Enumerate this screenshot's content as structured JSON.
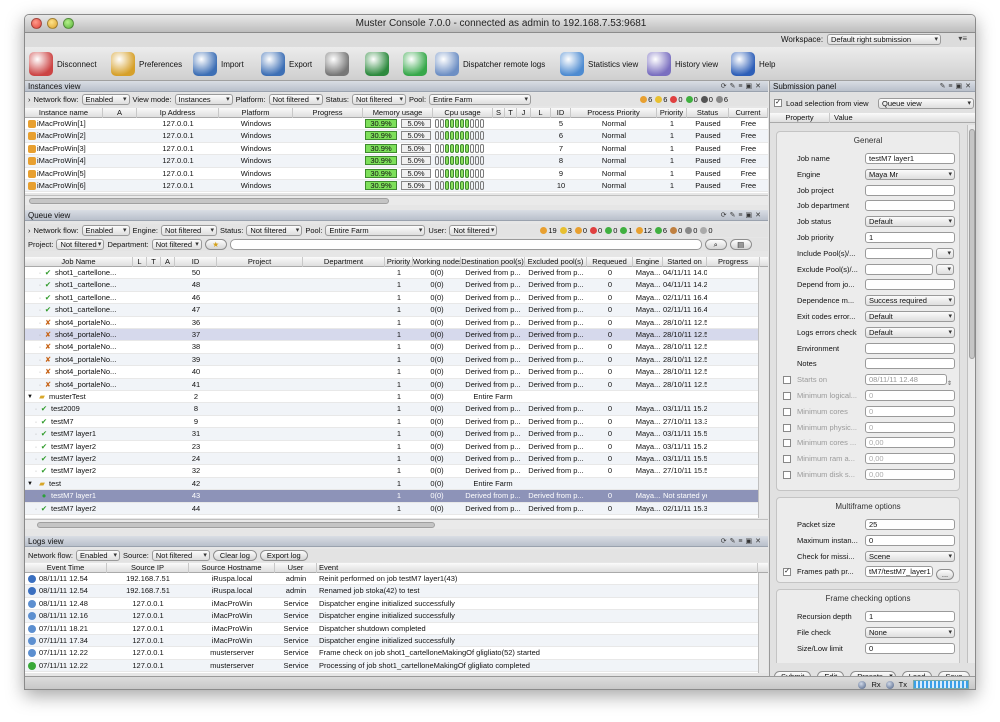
{
  "window": {
    "title": "Muster Console 7.0.0 - connected as admin to 192.168.7.53:9681"
  },
  "workspace": {
    "label": "Workspace:",
    "value": "Default right submission"
  },
  "toolbar": [
    {
      "label": "Disconnect",
      "icon": "disconnect-icon"
    },
    {
      "label": "Preferences",
      "icon": "preferences-icon"
    },
    {
      "label": "Import",
      "icon": "import-icon"
    },
    {
      "label": "Export",
      "icon": "export-icon"
    },
    {
      "label": "",
      "icon": "gears-icon"
    },
    {
      "label": "",
      "icon": "globe-refresh-icon"
    },
    {
      "label": "",
      "icon": "add-icon"
    },
    {
      "label": "Dispatcher remote logs",
      "icon": "document-icon"
    },
    {
      "label": "Statistics view",
      "icon": "statistics-icon"
    },
    {
      "label": "History view",
      "icon": "history-icon"
    },
    {
      "label": "Help",
      "icon": "help-icon"
    }
  ],
  "instances": {
    "title": "Instances view",
    "filters": {
      "network_label": "Network flow:",
      "network": "Enabled",
      "viewmode_label": "View mode:",
      "viewmode": "Instances",
      "platform_label": "Platform:",
      "platform": "Not filtered",
      "status_label": "Status:",
      "status": "Not filtered",
      "pool_label": "Pool:",
      "pool": "Entire Farm",
      "counts": [
        "6",
        "6",
        "0",
        "0",
        "0",
        "6"
      ]
    },
    "columns": [
      "Instance name",
      "A",
      "Ip Address",
      "Platform",
      "Progress",
      "Memory usage",
      "Cpu usage",
      "S",
      "T",
      "J",
      "L",
      "ID",
      "Process Priority",
      "Priority",
      "Status",
      "Current"
    ],
    "rows": [
      {
        "name": "iMacProWin[1]",
        "ip": "127.0.0.1",
        "platform": "Windows",
        "mem1": "30.9%",
        "mem2": "5.0%",
        "id": "5",
        "pp": "Normal",
        "prio": "1",
        "status": "Paused",
        "cur": "Free"
      },
      {
        "name": "iMacProWin[2]",
        "ip": "127.0.0.1",
        "platform": "Windows",
        "mem1": "30.9%",
        "mem2": "5.0%",
        "id": "6",
        "pp": "Normal",
        "prio": "1",
        "status": "Paused",
        "cur": "Free"
      },
      {
        "name": "iMacProWin[3]",
        "ip": "127.0.0.1",
        "platform": "Windows",
        "mem1": "30.9%",
        "mem2": "5.0%",
        "id": "7",
        "pp": "Normal",
        "prio": "1",
        "status": "Paused",
        "cur": "Free"
      },
      {
        "name": "iMacProWin[4]",
        "ip": "127.0.0.1",
        "platform": "Windows",
        "mem1": "30.9%",
        "mem2": "5.0%",
        "id": "8",
        "pp": "Normal",
        "prio": "1",
        "status": "Paused",
        "cur": "Free"
      },
      {
        "name": "iMacProWin[5]",
        "ip": "127.0.0.1",
        "platform": "Windows",
        "mem1": "30.9%",
        "mem2": "5.0%",
        "id": "9",
        "pp": "Normal",
        "prio": "1",
        "status": "Paused",
        "cur": "Free"
      },
      {
        "name": "iMacProWin[6]",
        "ip": "127.0.0.1",
        "platform": "Windows",
        "mem1": "30.9%",
        "mem2": "5.0%",
        "id": "10",
        "pp": "Normal",
        "prio": "1",
        "status": "Paused",
        "cur": "Free"
      }
    ]
  },
  "queue": {
    "title": "Queue view",
    "filters": {
      "network_label": "Network flow:",
      "network": "Enabled",
      "engine_label": "Engine:",
      "engine": "Not filtered",
      "status_label": "Status:",
      "status": "Not filtered",
      "pool_label": "Pool:",
      "pool": "Entire Farm",
      "user_label": "User:",
      "user": "Not filtered",
      "project_label": "Project:",
      "project": "Not filtered",
      "department_label": "Department:",
      "department": "Not filtered",
      "counts": [
        "19",
        "3",
        "0",
        "0",
        "0",
        "1",
        "12",
        "6",
        "0",
        "0",
        "0"
      ]
    },
    "columns": [
      "Job Name",
      "L",
      "T",
      "A",
      "ID",
      "Project",
      "Department",
      "Priority",
      "Working nodes",
      "Destination pool(s)",
      "Excluded pool(s)",
      "Requeued",
      "Engine",
      "Started on",
      "Progress"
    ],
    "rows": [
      {
        "name": "shot1_cartellone...",
        "id": "50",
        "prio": "1",
        "nodes": "0(0)",
        "dest": "Derived from p...",
        "excl": "Derived from p...",
        "req": "0",
        "eng": "Maya...",
        "started": "04/11/11 14.07",
        "prog": "Completed",
        "st": "c",
        "ind": 2,
        "icon": "check"
      },
      {
        "name": "shot1_cartellone...",
        "id": "48",
        "prio": "1",
        "nodes": "0(0)",
        "dest": "Derived from p...",
        "excl": "Derived from p...",
        "req": "0",
        "eng": "Maya...",
        "started": "04/11/11 14.24",
        "prog": "Completed",
        "st": "c",
        "ind": 2,
        "icon": "check"
      },
      {
        "name": "shot1_cartellone...",
        "id": "46",
        "prio": "1",
        "nodes": "0(0)",
        "dest": "Derived from p...",
        "excl": "Derived from p...",
        "req": "0",
        "eng": "Maya...",
        "started": "02/11/11 16.47",
        "prog": "Completed",
        "st": "c",
        "ind": 2,
        "icon": "check"
      },
      {
        "name": "shot1_cartellone...",
        "id": "47",
        "prio": "1",
        "nodes": "0(0)",
        "dest": "Derived from p...",
        "excl": "Derived from p...",
        "req": "0",
        "eng": "Maya...",
        "started": "02/11/11 16.48",
        "prog": "Completed",
        "st": "c",
        "ind": 2,
        "icon": "check"
      },
      {
        "name": "shot4_portaleNo...",
        "id": "36",
        "prio": "1",
        "nodes": "0(0)",
        "dest": "Derived from p...",
        "excl": "Derived from p...",
        "req": "0",
        "eng": "Maya...",
        "started": "28/10/11 12.50",
        "prog": "Completed",
        "st": "p",
        "ind": 2,
        "icon": "warn"
      },
      {
        "name": "shot4_portaleNo...",
        "id": "37",
        "prio": "1",
        "nodes": "0(0)",
        "dest": "Derived from p...",
        "excl": "Derived from p...",
        "req": "0",
        "eng": "Maya...",
        "started": "28/10/11 12.51",
        "prog": "Completed",
        "st": "p",
        "ind": 2,
        "icon": "warn",
        "hl": true
      },
      {
        "name": "shot4_portaleNo...",
        "id": "38",
        "prio": "1",
        "nodes": "0(0)",
        "dest": "Derived from p...",
        "excl": "Derived from p...",
        "req": "0",
        "eng": "Maya...",
        "started": "28/10/11 12.51",
        "prog": "Completed",
        "st": "p",
        "ind": 2,
        "icon": "warn"
      },
      {
        "name": "shot4_portaleNo...",
        "id": "39",
        "prio": "1",
        "nodes": "0(0)",
        "dest": "Derived from p...",
        "excl": "Derived from p...",
        "req": "0",
        "eng": "Maya...",
        "started": "28/10/11 12.53",
        "prog": "Completed",
        "st": "p",
        "ind": 2,
        "icon": "warn"
      },
      {
        "name": "shot4_portaleNo...",
        "id": "40",
        "prio": "1",
        "nodes": "0(0)",
        "dest": "Derived from p...",
        "excl": "Derived from p...",
        "req": "0",
        "eng": "Maya...",
        "started": "28/10/11 12.55",
        "prog": "Completed",
        "st": "p",
        "ind": 2,
        "icon": "warn"
      },
      {
        "name": "shot4_portaleNo...",
        "id": "41",
        "prio": "1",
        "nodes": "0(0)",
        "dest": "Derived from p...",
        "excl": "Derived from p...",
        "req": "0",
        "eng": "Maya...",
        "started": "28/10/11 12.57",
        "prog": "Completed",
        "st": "p",
        "ind": 2,
        "icon": "warn"
      },
      {
        "name": "musterTest",
        "id": "2",
        "prio": "1",
        "nodes": "0(0)",
        "dest": "Entire Farm",
        "excl": "",
        "req": "",
        "eng": "",
        "started": "",
        "prog": "",
        "st": "",
        "ind": 0,
        "icon": "folder"
      },
      {
        "name": "test2009",
        "id": "8",
        "prio": "1",
        "nodes": "0(0)",
        "dest": "Derived from p...",
        "excl": "Derived from p...",
        "req": "0",
        "eng": "Maya...",
        "started": "03/11/11 15.28",
        "prog": "Completed",
        "st": "c",
        "ind": 1,
        "icon": "check"
      },
      {
        "name": "testM7",
        "id": "9",
        "prio": "1",
        "nodes": "0(0)",
        "dest": "Derived from p...",
        "excl": "Derived from p...",
        "req": "0",
        "eng": "Maya...",
        "started": "27/10/11 13.30",
        "prog": "Completed",
        "st": "c",
        "ind": 1,
        "icon": "check"
      },
      {
        "name": "testM7 layer1",
        "id": "31",
        "prio": "1",
        "nodes": "0(0)",
        "dest": "Derived from p...",
        "excl": "Derived from p...",
        "req": "0",
        "eng": "Maya...",
        "started": "03/11/11 15.56",
        "prog": "Completed",
        "st": "c",
        "ind": 1,
        "icon": "check"
      },
      {
        "name": "testM7 layer2",
        "id": "23",
        "prio": "1",
        "nodes": "0(0)",
        "dest": "Derived from p...",
        "excl": "Derived from p...",
        "req": "0",
        "eng": "Maya...",
        "started": "03/11/11 15.28",
        "prog": "Completed",
        "st": "c",
        "ind": 1,
        "icon": "check"
      },
      {
        "name": "testM7 layer2",
        "id": "24",
        "prio": "1",
        "nodes": "0(0)",
        "dest": "Derived from p...",
        "excl": "Derived from p...",
        "req": "0",
        "eng": "Maya...",
        "started": "03/11/11 15.53",
        "prog": "Completed",
        "st": "c",
        "ind": 1,
        "icon": "check"
      },
      {
        "name": "testM7 layer2",
        "id": "32",
        "prio": "1",
        "nodes": "0(0)",
        "dest": "Derived from p...",
        "excl": "Derived from p...",
        "req": "0",
        "eng": "Maya...",
        "started": "27/10/11 15.51",
        "prog": "Completed",
        "st": "c",
        "ind": 1,
        "icon": "check"
      },
      {
        "name": "test",
        "id": "42",
        "prio": "1",
        "nodes": "0(0)",
        "dest": "Entire Farm",
        "excl": "",
        "req": "",
        "eng": "",
        "started": "",
        "prog": "",
        "st": "",
        "ind": 0,
        "icon": "folder"
      },
      {
        "name": "testM7 layer1",
        "id": "43",
        "prio": "1",
        "nodes": "0(0)",
        "dest": "Derived from p...",
        "excl": "Derived from p...",
        "req": "0",
        "eng": "Maya...",
        "started": "Not started yet!",
        "prog": "On queue",
        "st": "q",
        "ind": 1,
        "icon": "queue",
        "sel": true
      },
      {
        "name": "testM7 layer2",
        "id": "44",
        "prio": "1",
        "nodes": "0(0)",
        "dest": "Derived from p...",
        "excl": "Derived from p...",
        "req": "0",
        "eng": "Maya...",
        "started": "02/11/11 15.30",
        "prog": "Completed",
        "st": "c",
        "ind": 1,
        "icon": "check"
      }
    ]
  },
  "logs": {
    "title": "Logs view",
    "filters": {
      "network_label": "Network flow:",
      "network": "Enabled",
      "source_label": "Source:",
      "source": "Not filtered",
      "clear": "Clear log",
      "export": "Export log"
    },
    "columns": [
      "Event Time",
      "Source IP",
      "Source Hostname",
      "User",
      "Event"
    ],
    "rows": [
      {
        "time": "08/11/11 12.54",
        "ip": "192.168.7.51",
        "host": "iRuspa.local",
        "user": "admin",
        "event": "Reinit performed on job testM7 layer1(43)",
        "icon": "user"
      },
      {
        "time": "08/11/11 12.54",
        "ip": "192.168.7.51",
        "host": "iRuspa.local",
        "user": "admin",
        "event": "Renamed job stoka(42) to test",
        "icon": "user"
      },
      {
        "time": "08/11/11 12.48",
        "ip": "127.0.0.1",
        "host": "iMacProWin",
        "user": "Service",
        "event": "Dispatcher engine initialized successfully",
        "icon": "svc"
      },
      {
        "time": "08/11/11 12.16",
        "ip": "127.0.0.1",
        "host": "iMacProWin",
        "user": "Service",
        "event": "Dispatcher engine initialized successfully",
        "icon": "svc"
      },
      {
        "time": "07/11/11 18.21",
        "ip": "127.0.0.1",
        "host": "iMacProWin",
        "user": "Service",
        "event": "Dispatcher shutdown completed",
        "icon": "svc"
      },
      {
        "time": "07/11/11 17.34",
        "ip": "127.0.0.1",
        "host": "iMacProWin",
        "user": "Service",
        "event": "Dispatcher engine initialized successfully",
        "icon": "svc"
      },
      {
        "time": "07/11/11 12.22",
        "ip": "127.0.0.1",
        "host": "musterserver",
        "user": "Service",
        "event": "Frame check on job shot1_cartelloneMakingOf gligliato(52) started",
        "icon": "svc"
      },
      {
        "time": "07/11/11 12.22",
        "ip": "127.0.0.1",
        "host": "musterserver",
        "user": "Service",
        "event": "Processing of job shot1_cartelloneMakingOf gligliato completed",
        "icon": "green"
      }
    ]
  },
  "submission": {
    "title": "Submission panel",
    "load_label": "Load selection from view",
    "load_value": "Queue view",
    "prop_col": "Property",
    "val_col": "Value",
    "general_title": "General",
    "general": [
      {
        "label": "Job name",
        "value": "testM7 layer1",
        "kind": "field"
      },
      {
        "label": "Engine",
        "value": "Maya Mr",
        "kind": "combo"
      },
      {
        "label": "Job project",
        "value": "",
        "kind": "field"
      },
      {
        "label": "Job department",
        "value": "",
        "kind": "field"
      },
      {
        "label": "Job status",
        "value": "Default",
        "kind": "combo"
      },
      {
        "label": "Job priority",
        "value": "1",
        "kind": "field"
      },
      {
        "label": "Include Pool(s)/...",
        "value": "",
        "kind": "combo2"
      },
      {
        "label": "Exclude Pool(s)/...",
        "value": "",
        "kind": "combo2"
      },
      {
        "label": "Depend from jo...",
        "value": "",
        "kind": "field"
      },
      {
        "label": "Dependence m...",
        "value": "Success required",
        "kind": "combo"
      },
      {
        "label": "Exit codes error...",
        "value": "Default",
        "kind": "combo"
      },
      {
        "label": "Logs errors check",
        "value": "Default",
        "kind": "combo"
      },
      {
        "label": "Environment",
        "value": "",
        "kind": "field"
      },
      {
        "label": "Notes",
        "value": "",
        "kind": "field"
      },
      {
        "label": "Starts on",
        "value": "08/11/11 12.48",
        "kind": "spin",
        "cb": true,
        "dis": true
      },
      {
        "label": "Minimum logical...",
        "value": "0",
        "kind": "field",
        "cb": true,
        "dis": true
      },
      {
        "label": "Minimum cores",
        "value": "0",
        "kind": "field",
        "cb": true,
        "dis": true
      },
      {
        "label": "Minimum physic...",
        "value": "0",
        "kind": "field",
        "cb": true,
        "dis": true
      },
      {
        "label": "Minimum cores ...",
        "value": "0,00",
        "kind": "field",
        "cb": true,
        "dis": true
      },
      {
        "label": "Minimum ram a...",
        "value": "0,00",
        "kind": "field",
        "cb": true,
        "dis": true
      },
      {
        "label": "Minimum disk s...",
        "value": "0,00",
        "kind": "field",
        "cb": true,
        "dis": true
      }
    ],
    "multi_title": "Multiframe options",
    "multi": [
      {
        "label": "Packet size",
        "value": "25",
        "kind": "field"
      },
      {
        "label": "Maximum instan...",
        "value": "0",
        "kind": "field"
      },
      {
        "label": "Check for missi...",
        "value": "Scene",
        "kind": "combo"
      },
      {
        "label": "Frames path pr...",
        "value": "tM7/testM7_layer1",
        "kind": "browse",
        "cb": true,
        "checked": true
      }
    ],
    "check_title": "Frame checking options",
    "check": [
      {
        "label": "Recursion depth",
        "value": "1",
        "kind": "field"
      },
      {
        "label": "File check",
        "value": "None",
        "kind": "combo"
      },
      {
        "label": "Size/Low limit",
        "value": "0",
        "kind": "field"
      }
    ],
    "buttons": [
      "Submit",
      "Edit",
      "Presets",
      "Load",
      "Save"
    ]
  },
  "statusbar": {
    "rx": "Rx",
    "tx": "Tx"
  }
}
